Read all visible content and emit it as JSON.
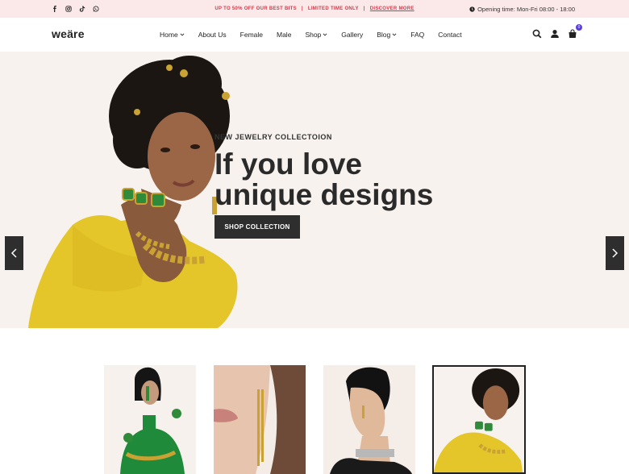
{
  "topbar": {
    "socials": [
      "facebook-icon",
      "instagram-icon",
      "tiktok-icon",
      "whatsapp-icon"
    ],
    "promo": "UP TO 50% OFF OUR BEST BITS",
    "separator": "|",
    "limited": "LIMITED TIME ONLY",
    "discover": "DISCOVER MORE",
    "hours": "Opening time: Mon-Fri 08:00 - 18:00"
  },
  "header": {
    "logo": "weäre",
    "nav": [
      {
        "label": "Home",
        "dropdown": true
      },
      {
        "label": "About Us",
        "dropdown": false
      },
      {
        "label": "Female",
        "dropdown": false
      },
      {
        "label": "Male",
        "dropdown": false
      },
      {
        "label": "Shop",
        "dropdown": true
      },
      {
        "label": "Gallery",
        "dropdown": false
      },
      {
        "label": "Blog",
        "dropdown": true
      },
      {
        "label": "FAQ",
        "dropdown": false
      },
      {
        "label": "Contact",
        "dropdown": false
      }
    ],
    "cart_count": "0"
  },
  "hero": {
    "kicker": "NEW JEWELRY COLLECTOION",
    "title_line1": "If you love",
    "title_line2": "unique designs",
    "button": "SHOP COLLECTION"
  },
  "colors": {
    "accent_red": "#d13b4b",
    "badge": "#5a3de0",
    "dark": "#2e2e2e",
    "hero_bg": "#f7f2ee",
    "topbar_bg": "#fbe9ea"
  }
}
